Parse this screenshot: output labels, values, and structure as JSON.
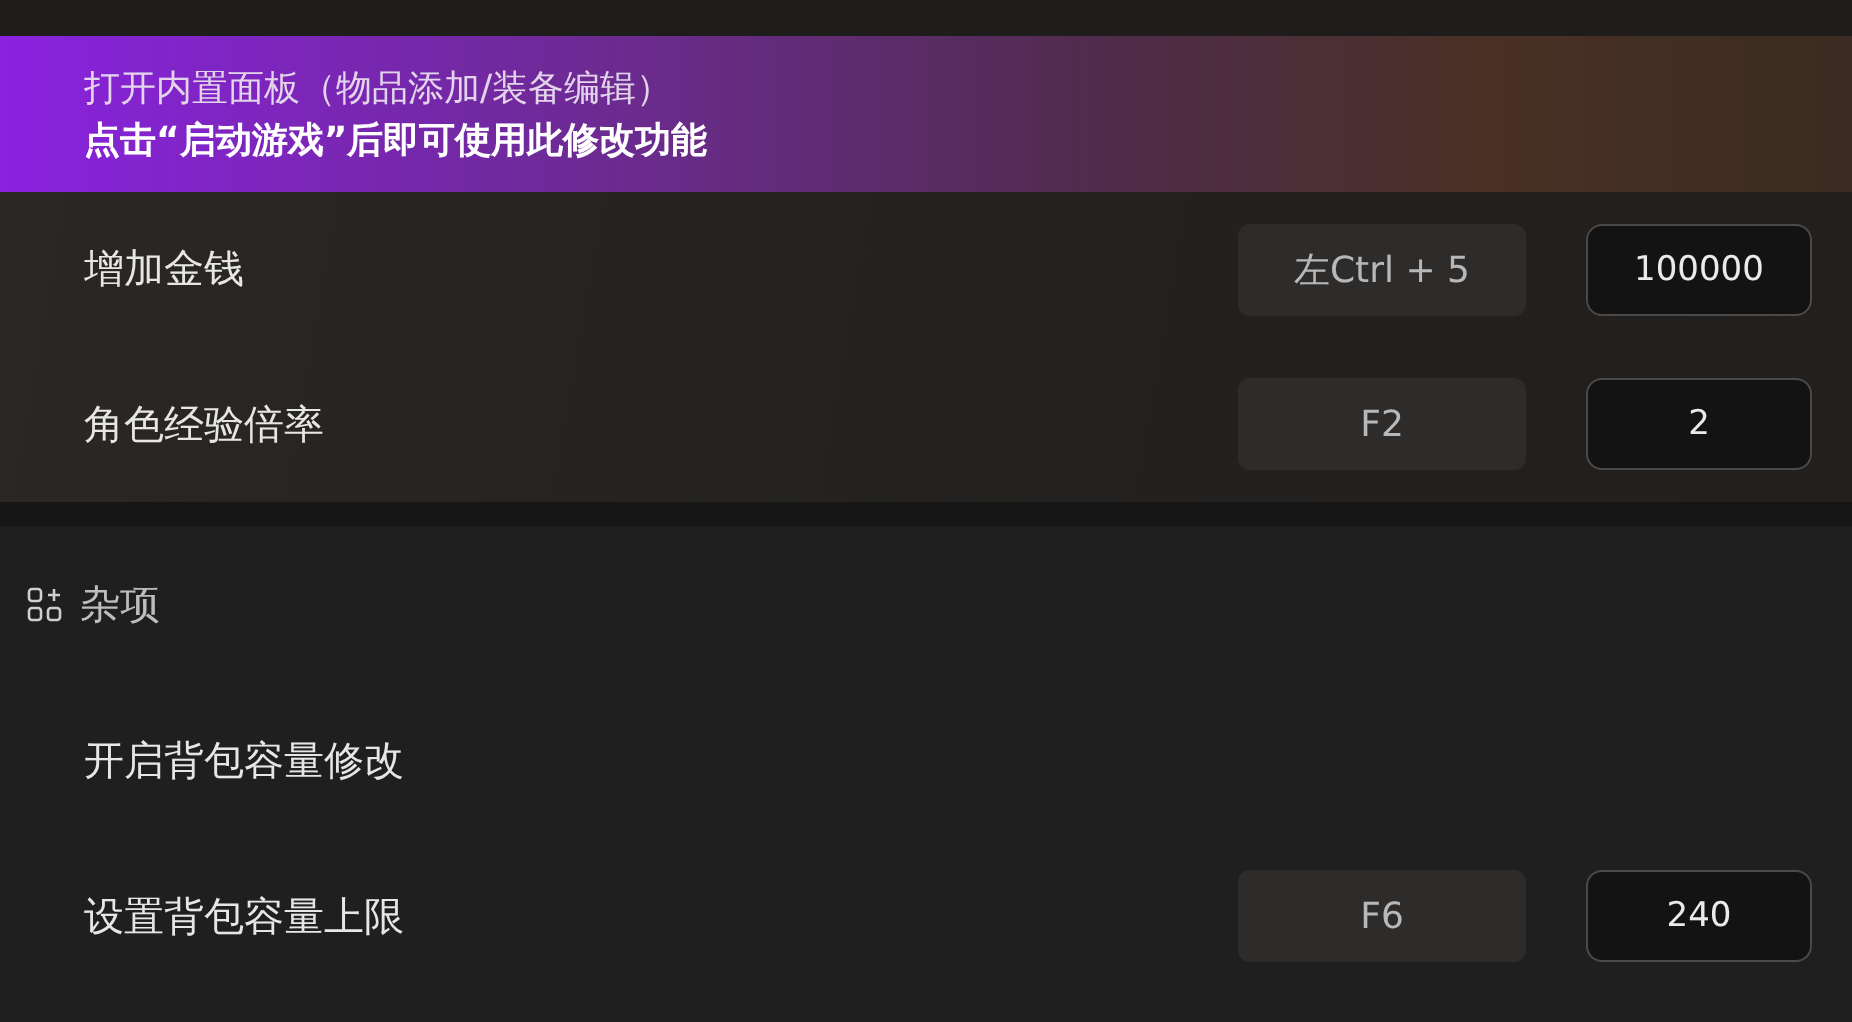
{
  "banner": {
    "title": "打开内置面板（物品添加/装备编辑）",
    "subtitle": "点击“启动游戏”后即可使用此修改功能"
  },
  "top_rows": [
    {
      "kind": "hotkey_value",
      "label": "增加金钱",
      "hotkey": "左Ctrl + 5",
      "value": "100000"
    },
    {
      "kind": "hotkey_value",
      "label": "角色经验倍率",
      "hotkey": "F2",
      "value": "2"
    }
  ],
  "section": {
    "title": "杂项"
  },
  "rows": [
    {
      "kind": "plain",
      "label": "开启背包容量修改"
    },
    {
      "kind": "hotkey_value",
      "label": "设置背包容量上限",
      "hotkey": "F6",
      "value": "240"
    }
  ]
}
